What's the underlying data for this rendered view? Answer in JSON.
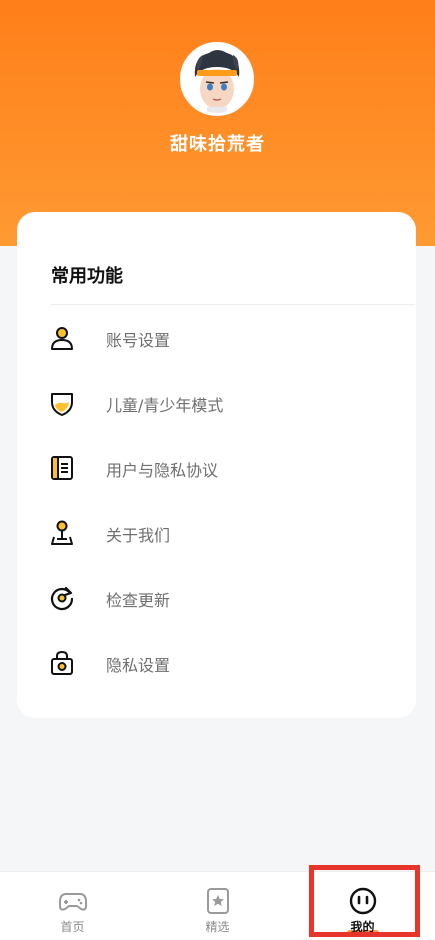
{
  "profile": {
    "username": "甜味拾荒者"
  },
  "card": {
    "title": "常用功能",
    "items": [
      {
        "label": "账号设置",
        "icon": "user-icon"
      },
      {
        "label": "儿童/青少年模式",
        "icon": "shield-icon"
      },
      {
        "label": "用户与隐私协议",
        "icon": "document-icon"
      },
      {
        "label": "关于我们",
        "icon": "joystick-icon"
      },
      {
        "label": "检查更新",
        "icon": "refresh-icon"
      },
      {
        "label": "隐私设置",
        "icon": "lock-icon"
      }
    ]
  },
  "tabbar": {
    "tabs": [
      {
        "label": "首页",
        "icon": "gamepad-icon"
      },
      {
        "label": "精选",
        "icon": "star-badge-icon"
      },
      {
        "label": "我的",
        "icon": "face-icon"
      }
    ],
    "active_index": 2
  },
  "colors": {
    "accent": "#ff8c2a",
    "icon_fill": "#ffc02e",
    "highlight": "#e8352a"
  }
}
